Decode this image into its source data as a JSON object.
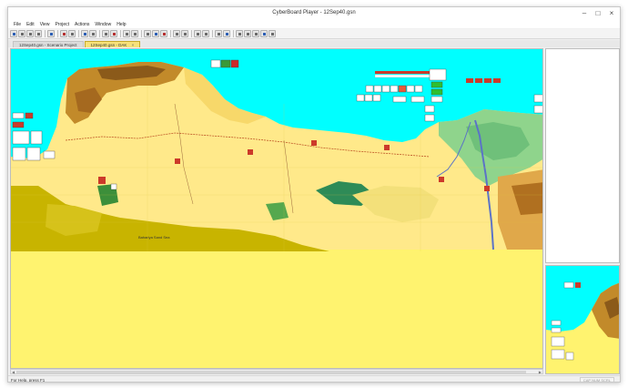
{
  "window": {
    "title": "CyberBoard Player - 12Sep40.gsn"
  },
  "menu": [
    "File",
    "Edit",
    "View",
    "Project",
    "Actions",
    "Window",
    "Help"
  ],
  "toolbar_icons": [
    "new-file-icon",
    "open-folder-icon",
    "save-icon",
    "print-icon",
    "separator",
    "context-help-icon",
    "separator",
    "zoom-in-icon",
    "zoom-out-icon",
    "separator",
    "select-tool-icon",
    "move-tool-icon",
    "separator",
    "draw-line-icon",
    "draw-text-icon",
    "separator",
    "toggle-grid-icon",
    "toggle-pieces-icon",
    "separator",
    "rotate-left-icon",
    "rotate-right-icon",
    "flip-icon",
    "separator",
    "stack-icon",
    "unstack-icon",
    "separator",
    "lock-icon",
    "view-icon",
    "separator",
    "record-icon",
    "playback-icon",
    "separator",
    "first-move-icon",
    "previous-move-icon",
    "next-move-icon",
    "last-move-icon",
    "stop-icon"
  ],
  "tabs": [
    {
      "label": "12Sep40.gsn - Scenario Project",
      "active": false
    },
    {
      "label": "12Sep40.gsn - DAK",
      "active": true,
      "close": "×"
    }
  ],
  "map": {
    "label": "Bahariya Sand Sea"
  },
  "statusbar": {
    "text": "For Help, press F1",
    "indicator": "CAP NUM SCRL"
  },
  "colors": {
    "sea": "#00ffff",
    "desert": "#fff36f",
    "highlands": "#b8860b",
    "marsh": "#2e8b57",
    "river": "#5b73c7"
  }
}
